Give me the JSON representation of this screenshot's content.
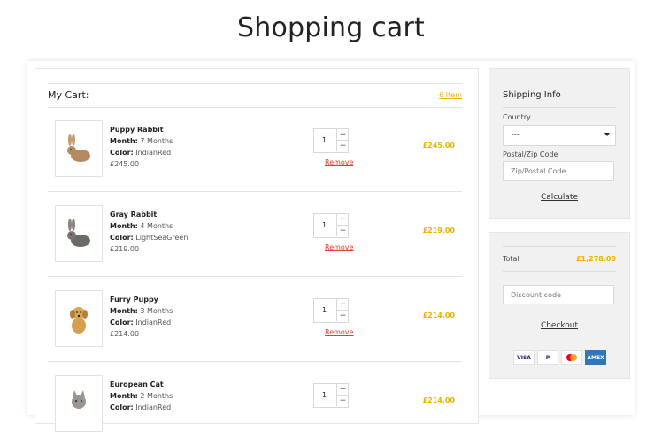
{
  "page": {
    "title": "Shopping cart"
  },
  "cart": {
    "label": "My Cart:",
    "count": "6 Item",
    "items": [
      {
        "name": "Puppy Rabbit",
        "month_label": "Month:",
        "month": "7 Months",
        "color_label": "Color:",
        "color": "IndianRed",
        "unit_price": "£245.00",
        "qty": "1",
        "remove": "Remove",
        "total": "£245.00",
        "image_icon": "rabbit-icon"
      },
      {
        "name": "Gray Rabbit",
        "month_label": "Month:",
        "month": "4 Months",
        "color_label": "Color:",
        "color": "LightSeaGreen",
        "unit_price": "£219.00",
        "qty": "1",
        "remove": "Remove",
        "total": "£219.00",
        "image_icon": "rabbit-icon"
      },
      {
        "name": "Furry Puppy",
        "month_label": "Month:",
        "month": "3 Months",
        "color_label": "Color:",
        "color": "IndianRed",
        "unit_price": "£214.00",
        "qty": "1",
        "remove": "Remove",
        "total": "£214.00",
        "image_icon": "puppy-icon"
      },
      {
        "name": "European Cat",
        "month_label": "Month:",
        "month": "2 Months",
        "color_label": "Color:",
        "color": "IndianRed",
        "unit_price": "",
        "qty": "1",
        "remove": "",
        "total": "£214.00",
        "image_icon": "cat-icon"
      }
    ]
  },
  "shipping": {
    "title": "Shipping Info",
    "country_label": "Country",
    "country_value": "---",
    "postal_label": "Postal/Zip Code",
    "postal_placeholder": "Zip/Postal Code",
    "calculate": "Calculate"
  },
  "summary": {
    "total_label": "Total",
    "total_value": "£1,278.00",
    "discount_placeholder": "Discount code",
    "checkout": "Checkout",
    "payment_icons": [
      "visa-icon",
      "paypal-icon",
      "mastercard-icon",
      "amex-icon"
    ],
    "payment_labels": [
      "VISA",
      "P",
      "",
      "AMEX"
    ]
  },
  "colors": {
    "accent": "#e8b400",
    "remove": "#e53935"
  }
}
